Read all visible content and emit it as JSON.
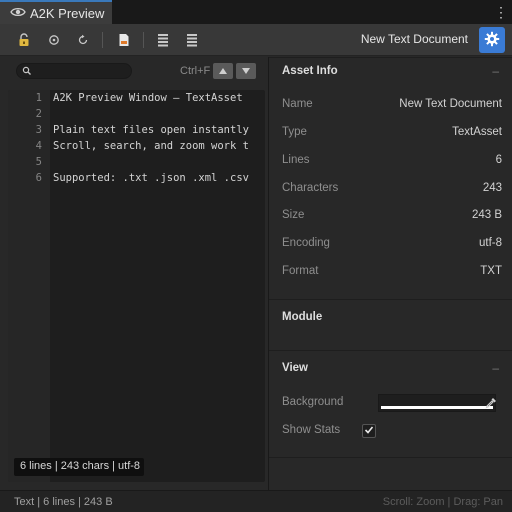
{
  "window": {
    "tab_title": "A2K Preview",
    "menu_icon": "kebab-menu-icon"
  },
  "toolbar": {
    "icons": [
      "lock-icon",
      "record-icon",
      "refresh-icon",
      "document-icon",
      "align-left-icon",
      "align-justify-icon"
    ],
    "document_title": "New Text Document",
    "settings_icon": "gear-icon"
  },
  "search": {
    "placeholder": "",
    "shortcut": "Ctrl+F"
  },
  "editor": {
    "lines": [
      {
        "num": "1",
        "text": "A2K Preview Window — TextAsset"
      },
      {
        "num": "2",
        "text": ""
      },
      {
        "num": "3",
        "text": "Plain text files open instantly"
      },
      {
        "num": "4",
        "text": "Scroll, search, and zoom work t"
      },
      {
        "num": "5",
        "text": ""
      },
      {
        "num": "6",
        "text": "Supported: .txt .json .xml .csv"
      }
    ],
    "stats": "6 lines | 243 chars | utf-8"
  },
  "asset_info": {
    "title": "Asset Info",
    "props": [
      {
        "name": "Name",
        "value": "New Text Document"
      },
      {
        "name": "Type",
        "value": "TextAsset"
      },
      {
        "name": "Lines",
        "value": "6"
      },
      {
        "name": "Characters",
        "value": "243"
      },
      {
        "name": "Size",
        "value": "243 B"
      },
      {
        "name": "Encoding",
        "value": "utf-8"
      },
      {
        "name": "Format",
        "value": "TXT"
      }
    ]
  },
  "module": {
    "title": "Module"
  },
  "view": {
    "title": "View",
    "background_label": "Background",
    "background_color": "#ffffff",
    "show_stats_label": "Show Stats",
    "show_stats_checked": true
  },
  "status": {
    "left": "Text | 6 lines | 243 B",
    "right": "Scroll: Zoom | Drag: Pan"
  },
  "colors": {
    "accent": "#3a7bd5",
    "tab_indicator": "#3a79bb",
    "lock": "#e0b840"
  }
}
